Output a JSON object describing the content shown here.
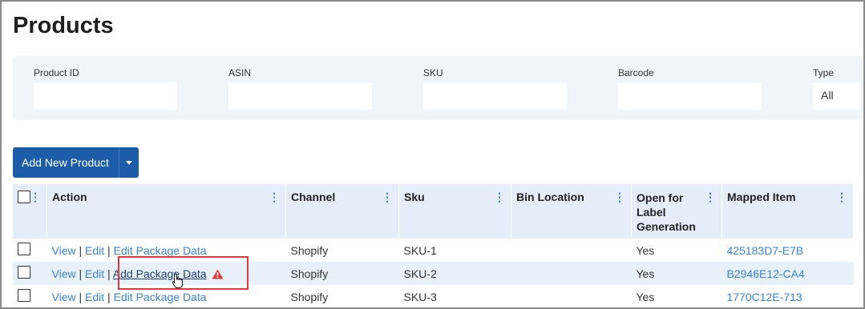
{
  "page": {
    "title": "Products"
  },
  "filters": [
    {
      "label": "Product ID",
      "value": ""
    },
    {
      "label": "ASIN",
      "value": ""
    },
    {
      "label": "SKU",
      "value": ""
    },
    {
      "label": "Barcode",
      "value": ""
    }
  ],
  "type_filter": {
    "label": "Type",
    "value": "All"
  },
  "toolbar": {
    "add_label": "Add New Product"
  },
  "table": {
    "headers": [
      "Action",
      "Channel",
      "Sku",
      "Bin Location",
      "Open for Label Generation",
      "Mapped Item"
    ],
    "rows": [
      {
        "view": "View",
        "edit": "Edit",
        "package": "Edit Package Data",
        "channel": "Shopify",
        "sku": "SKU-1",
        "bin": "",
        "open": "Yes",
        "mapped": "425183D7-E7B"
      },
      {
        "view": "View",
        "edit": "Edit",
        "package": "Add Package Data",
        "channel": "Shopify",
        "sku": "SKU-2",
        "bin": "",
        "open": "Yes",
        "mapped": "B2946E12-CA4"
      },
      {
        "view": "View",
        "edit": "Edit",
        "package": "Edit Package Data",
        "channel": "Shopify",
        "sku": "SKU-3",
        "bin": "",
        "open": "Yes",
        "mapped": "1770C12E-713"
      }
    ]
  },
  "icons": {
    "row_menu": "vertical-dots-icon",
    "warning": "warning-triangle-icon",
    "cursor": "hand-pointer-icon"
  },
  "colors": {
    "accent": "#1d5da8",
    "link": "#3a86d1",
    "highlight": "#e0393e",
    "warning": "#e0393e"
  }
}
